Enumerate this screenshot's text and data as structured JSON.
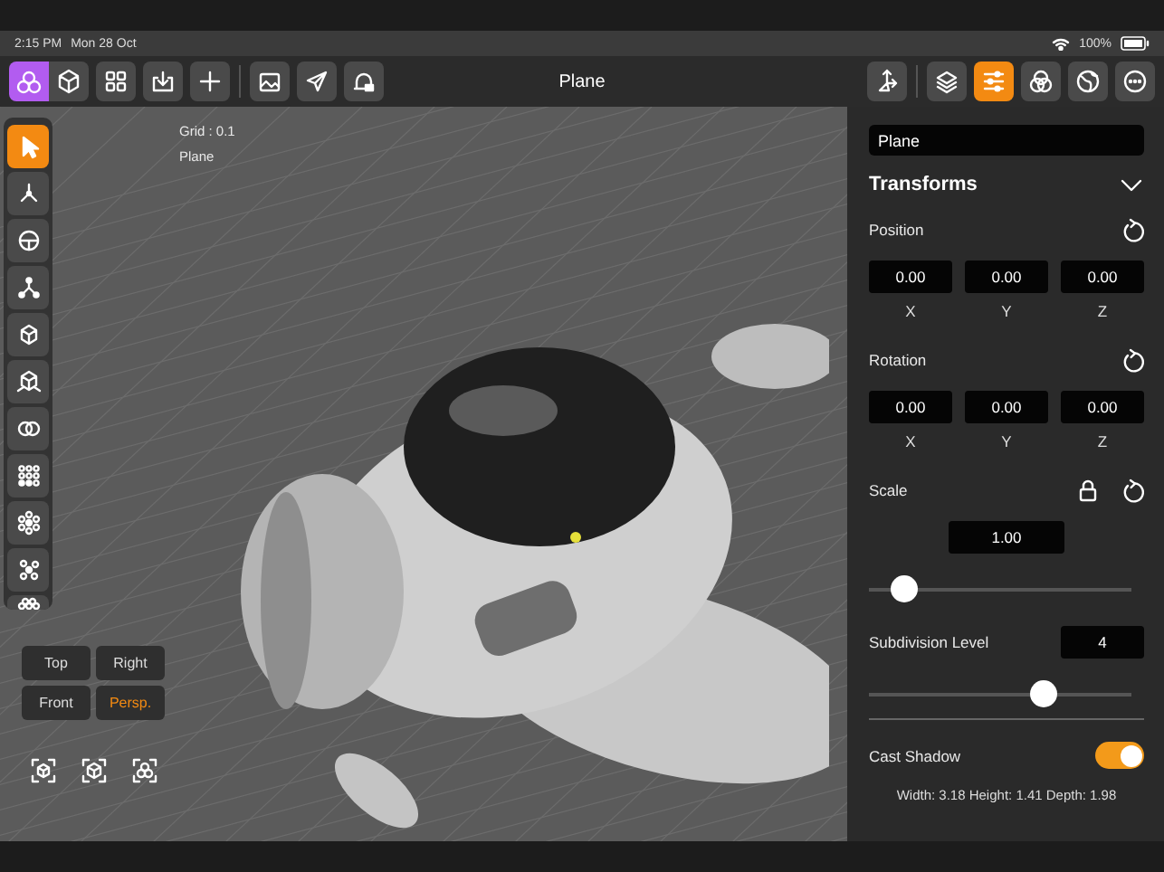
{
  "status_bar": {
    "time": "2:15 PM",
    "date": "Mon 28 Oct",
    "battery": "100%"
  },
  "toolbar": {
    "title": "Plane",
    "left_buttons": [
      {
        "selected": true
      },
      {
        "selected": false
      },
      {
        "selected": false
      },
      {
        "selected": false
      },
      {
        "selected": false
      },
      {
        "selected": false
      },
      {
        "selected": false
      },
      {
        "selected": false
      }
    ],
    "right_buttons": [
      {
        "selected": false
      },
      {
        "selected": false
      },
      {
        "selected": true
      },
      {
        "selected": false
      },
      {
        "selected": false
      },
      {
        "selected": false
      }
    ]
  },
  "viewport": {
    "grid_label": "Grid : 0.1",
    "object_label": "Plane",
    "tools": [
      {
        "selected": true
      },
      {
        "selected": false
      },
      {
        "selected": false
      },
      {
        "selected": false
      },
      {
        "selected": false
      },
      {
        "selected": false
      },
      {
        "selected": false
      },
      {
        "selected": false
      },
      {
        "selected": false
      },
      {
        "selected": false
      },
      {
        "selected": false
      }
    ],
    "views": [
      {
        "label": "Top",
        "selected": false
      },
      {
        "label": "Right",
        "selected": false
      },
      {
        "label": "Front",
        "selected": false
      },
      {
        "label": "Persp.",
        "selected": true
      }
    ]
  },
  "panel": {
    "name": "Plane",
    "section": "Transforms",
    "expanded": true,
    "groups": [
      {
        "label": "Position",
        "values": [
          {
            "value": "0.00",
            "axis": "X"
          },
          {
            "value": "0.00",
            "axis": "Y"
          },
          {
            "value": "0.00",
            "axis": "Z"
          }
        ]
      },
      {
        "label": "Rotation",
        "values": [
          {
            "value": "0.00",
            "axis": "X"
          },
          {
            "value": "0.00",
            "axis": "Y"
          },
          {
            "value": "0.00",
            "axis": "Z"
          }
        ]
      }
    ],
    "scale": {
      "label": "Scale",
      "locked": true,
      "value": "1.00",
      "level": 0.13
    },
    "subdivision": {
      "label": "Subdivision Level",
      "value": "4",
      "level": 0.66
    },
    "cast_shadow": {
      "label": "Cast Shadow",
      "on": true
    },
    "dimensions": "Width: 3.18 Height: 1.41 Depth: 1.98"
  }
}
